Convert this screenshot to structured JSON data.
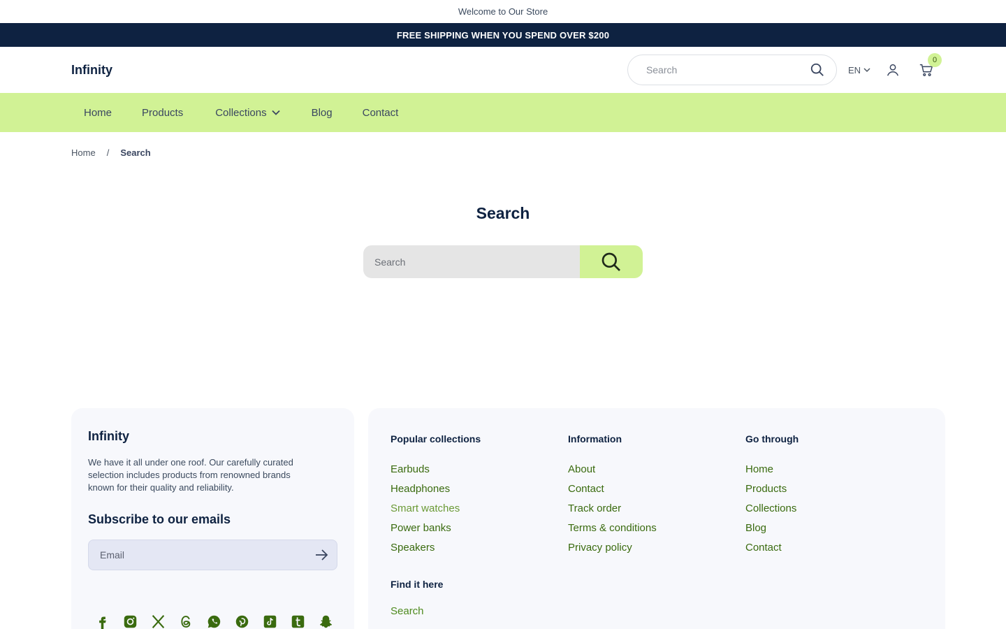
{
  "announcement": "Welcome to Our Store",
  "shipping_bar": "FREE SHIPPING WHEN YOU SPEND OVER $200",
  "header": {
    "logo": "Infinity",
    "search_placeholder": "Search",
    "language": "EN",
    "cart_count": "0"
  },
  "nav": {
    "items": [
      "Home",
      "Products",
      "Collections",
      "Blog",
      "Contact"
    ]
  },
  "breadcrumb": {
    "home": "Home",
    "separator": "/",
    "current": "Search"
  },
  "main": {
    "title": "Search",
    "search_placeholder": "Search"
  },
  "footer": {
    "logo": "Infinity",
    "description": "We have it all under one roof. Our carefully curated selection includes products from renowned brands known for their quality and reliability.",
    "subscribe_title": "Subscribe to our emails",
    "email_placeholder": "Email",
    "columns": [
      {
        "title": "Popular collections",
        "links": [
          "Earbuds",
          "Headphones",
          "Smart watches",
          "Power banks",
          "Speakers"
        ]
      },
      {
        "title": "Information",
        "links": [
          "About",
          "Contact",
          "Track order",
          "Terms & conditions",
          "Privacy policy"
        ]
      },
      {
        "title": "Go through",
        "links": [
          "Home",
          "Products",
          "Collections",
          "Blog",
          "Contact"
        ]
      }
    ],
    "find": {
      "title": "Find it here",
      "link": "Search"
    },
    "socials": [
      "facebook-icon",
      "instagram-icon",
      "x-icon",
      "threads-icon",
      "whatsapp-icon",
      "pinterest-icon",
      "tiktok-icon",
      "tumblr-icon",
      "snapchat-icon"
    ]
  },
  "colors": {
    "navy": "#0e2241",
    "lime": "#d1f295",
    "link_green": "#3a6b0f",
    "footer_bg": "#f7f8fc"
  }
}
